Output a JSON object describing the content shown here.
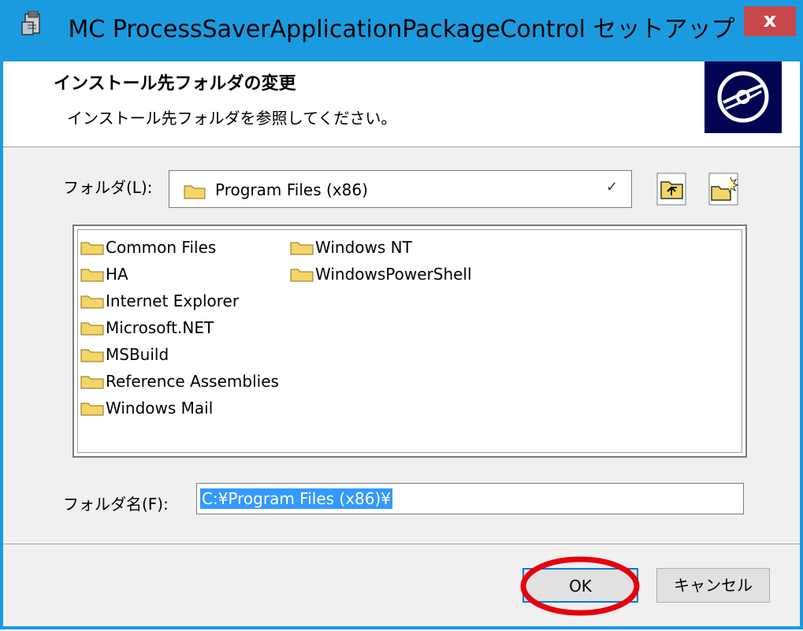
{
  "window": {
    "title": "MC ProcessSaverApplicationPackageControl セットアップ",
    "close_label": "x",
    "accent": "#1a9be0"
  },
  "header": {
    "title": "インストール先フォルダの変更",
    "subtitle": "インストール先フォルダを参照してください。",
    "icon": "disc-icon"
  },
  "folder_select": {
    "label": "フォルダ(L):",
    "value": "Program Files (x86)",
    "icon": "folder-icon"
  },
  "toolbar": {
    "up_icon": "folder-up-icon",
    "new_icon": "new-folder-icon"
  },
  "folder_list": {
    "items": [
      "Common Files",
      "HA",
      "Internet Explorer",
      "Microsoft.NET",
      "MSBuild",
      "Reference Assemblies",
      "Windows Mail",
      "Windows NT",
      "WindowsPowerShell"
    ]
  },
  "folder_name": {
    "label": "フォルダ名(F):",
    "value": "C:¥Program Files (x86)¥"
  },
  "buttons": {
    "ok": "OK",
    "cancel": "キャンセル"
  },
  "annotation": {
    "color": "#e8000b"
  }
}
